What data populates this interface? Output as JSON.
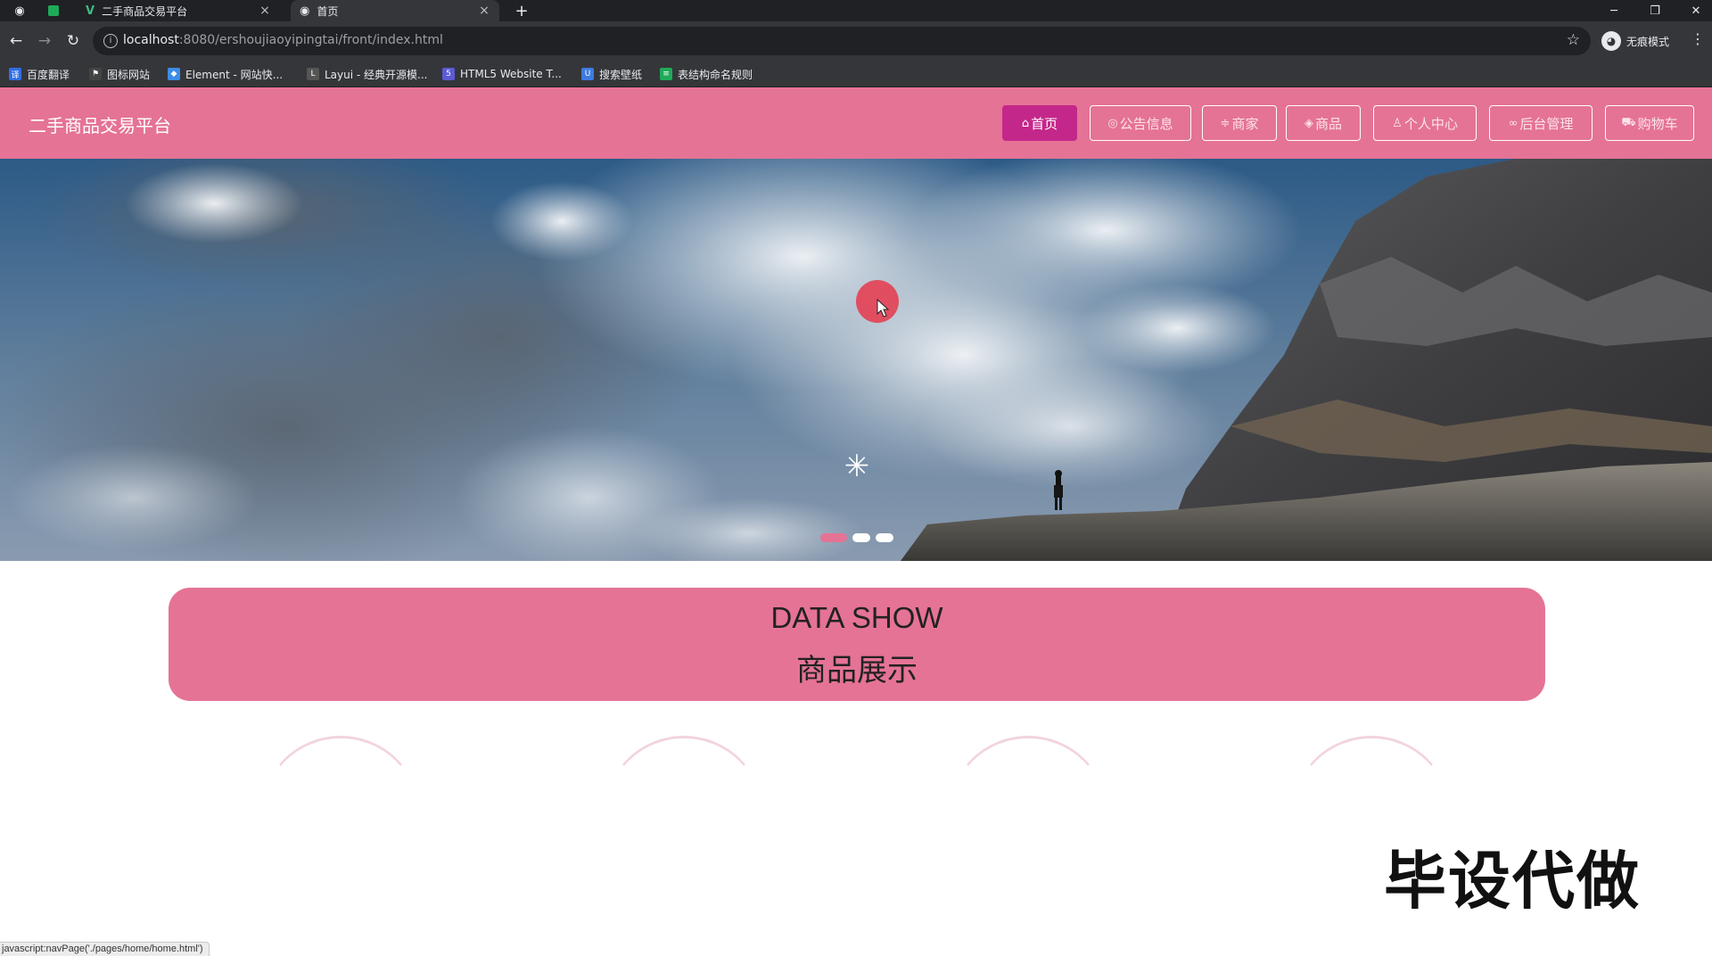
{
  "browser": {
    "tabs": [
      {
        "title": "二手商品交易平台",
        "close": "×",
        "icon": "vue-icon"
      },
      {
        "title": "首页",
        "close": "×",
        "icon": "globe-icon"
      }
    ],
    "new_tab": "+",
    "url_host": "localhost",
    "url_rest": ":8080/ershoujiaoyipingtai/front/index.html",
    "profile_label": "无痕模式",
    "bookmarks": [
      {
        "label": "百度翻译",
        "color": "#2f6fe4"
      },
      {
        "label": "图标网站",
        "color": "#444444"
      },
      {
        "label": "Element - 网站快...",
        "color": "#3c8ce7"
      },
      {
        "label": "Layui - 经典开源模...",
        "color": "#555555"
      },
      {
        "label": "HTML5 Website T...",
        "color": "#5b5bd6"
      },
      {
        "label": "搜索壁纸",
        "color": "#3d7be0"
      },
      {
        "label": "表结构命名规则",
        "color": "#1faa59"
      }
    ],
    "status_url": "javascript:navPage('./pages/home/home.html')"
  },
  "colors": {
    "primary": "#e57395",
    "active": "#c4278a"
  },
  "header": {
    "site_title": "二手商品交易平台",
    "nav": [
      {
        "label": "首页",
        "icon": "home-icon",
        "active": true
      },
      {
        "label": "公告信息",
        "icon": "bell-icon",
        "active": false
      },
      {
        "label": "商家",
        "icon": "shop-icon",
        "active": false
      },
      {
        "label": "商品",
        "icon": "box-icon",
        "active": false
      },
      {
        "label": "个人中心",
        "icon": "user-icon",
        "active": false
      },
      {
        "label": "后台管理",
        "icon": "link-icon",
        "active": false
      },
      {
        "label": "购物车",
        "icon": "cart-icon",
        "active": false
      }
    ]
  },
  "carousel": {
    "slides": 3,
    "active_index": 0
  },
  "section": {
    "title_en": "DATA SHOW",
    "title_zh": "商品展示"
  },
  "watermark": "毕设代做"
}
